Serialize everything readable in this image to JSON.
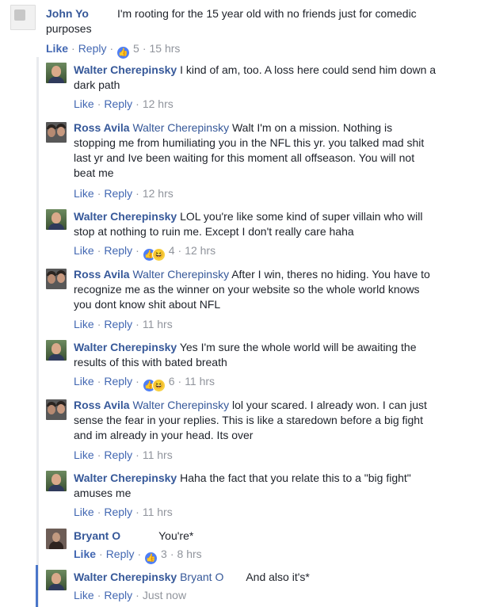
{
  "top_comment": {
    "author": "John Yo",
    "text": "I'm rooting for the 15 year old with no friends just for comedic purposes",
    "line1": "I'm rooting for the 15 year old with no friends just for comedic",
    "line2": "purposes",
    "like_label": "Like",
    "reply_label": "Reply",
    "reaction_count": "5",
    "timestamp": "15 hrs"
  },
  "replies": [
    {
      "author": "Walter Cherepinsky",
      "lines": [
        "I kind of am, too. A loss here could send him down a",
        "dark path"
      ],
      "like_label": "Like",
      "reply_label": "Reply",
      "timestamp": "12 hrs"
    },
    {
      "author": "Ross Avila",
      "mention": "Walter Cherepinsky",
      "lines": [
        "Walt I'm on a mission. Nothing is",
        "stopping me from humiliating you in the NFL this yr. you talked mad shit",
        "last yr and Ive been waiting for this moment all offseason. You will not",
        "beat me"
      ],
      "like_label": "Like",
      "reply_label": "Reply",
      "timestamp": "12 hrs"
    },
    {
      "author": "Walter Cherepinsky",
      "lines": [
        "LOL you're like some kind of super villain who will",
        "stop at nothing to ruin me. Except I don't really care haha"
      ],
      "like_label": "Like",
      "reply_label": "Reply",
      "reaction_count": "4",
      "timestamp": "12 hrs"
    },
    {
      "author": "Ross Avila",
      "mention": "Walter Cherepinsky",
      "lines": [
        "After I win, theres no hiding. You have to",
        "recognize me as the winner on your website so the whole world knows",
        "you dont know shit about NFL"
      ],
      "like_label": "Like",
      "reply_label": "Reply",
      "timestamp": "11 hrs"
    },
    {
      "author": "Walter Cherepinsky",
      "lines": [
        "Yes I'm sure the whole world will be awaiting the",
        "results of this with bated breath"
      ],
      "like_label": "Like",
      "reply_label": "Reply",
      "reaction_count": "6",
      "timestamp": "11 hrs"
    },
    {
      "author": "Ross Avila",
      "mention": "Walter Cherepinsky",
      "lines": [
        "lol your scared. I already won. I can just",
        "sense the fear in your replies. This is like a staredown before a big fight",
        "and im already in your head. Its over"
      ],
      "like_label": "Like",
      "reply_label": "Reply",
      "timestamp": "11 hrs"
    },
    {
      "author": "Walter Cherepinsky",
      "lines": [
        "Haha the fact that you relate this to a \"big fight\"",
        "amuses me"
      ],
      "like_label": "Like",
      "reply_label": "Reply",
      "timestamp": "11 hrs"
    },
    {
      "author": "Bryant O",
      "lines": [
        "You're*"
      ],
      "like_label": "Like",
      "reply_label": "Reply",
      "reaction_count": "3",
      "timestamp": "8 hrs"
    },
    {
      "author": "Walter Cherepinsky",
      "mention": "Bryant O",
      "lines": [
        "And also it's*"
      ],
      "like_label": "Like",
      "reply_label": "Reply",
      "timestamp": "Just now"
    }
  ],
  "colors": {
    "link_blue": "#365899",
    "like_blue": "#4267b2",
    "meta_gray": "#90949c",
    "thread_line": "#e9ebee",
    "highlight_bar": "#4a76c9"
  }
}
